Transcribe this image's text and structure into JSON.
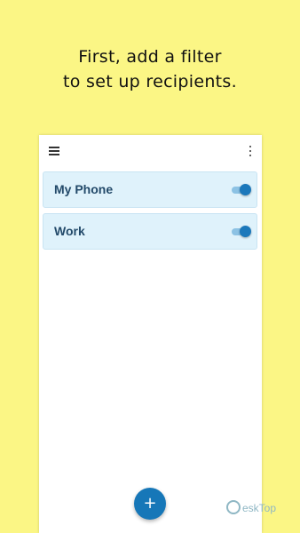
{
  "headline": {
    "line1": "First, add a filter",
    "line2": "to set up recipients."
  },
  "appbar": {
    "menu_icon": "hamburger-menu-icon",
    "more_icon": "more-vertical-icon"
  },
  "filters": [
    {
      "label": "My Phone",
      "enabled": true
    },
    {
      "label": "Work",
      "enabled": true
    }
  ],
  "fab": {
    "label": "+"
  },
  "watermark": {
    "text": "eskTop"
  },
  "colors": {
    "background": "#fbf685",
    "card": "#dff2fb",
    "accent": "#1677b8"
  }
}
